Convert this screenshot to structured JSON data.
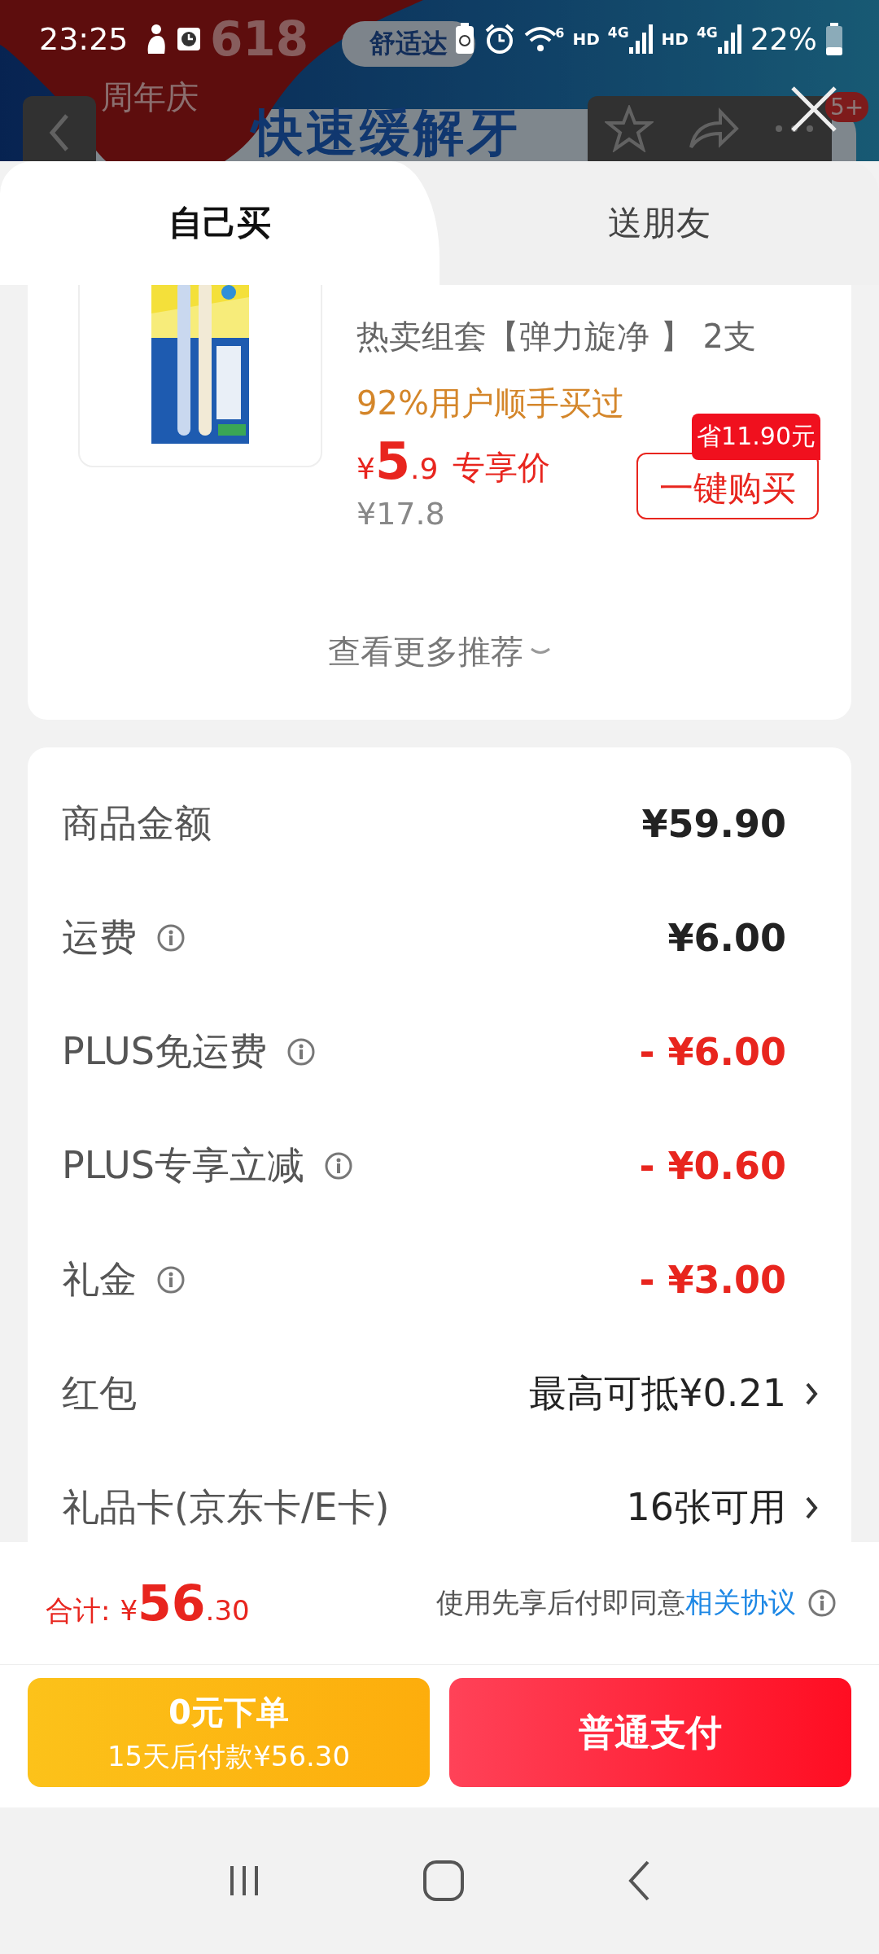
{
  "status_bar": {
    "time": "23:25",
    "wifi_tag": "6",
    "sims": [
      {
        "hd": "HD",
        "gen": "4G"
      },
      {
        "hd": "HD",
        "gen": "4G"
      }
    ],
    "battery": "22%"
  },
  "banner": {
    "badge_number": "618",
    "badge_label": "周年庆",
    "brand": "舒适达",
    "headline": "快速缓解牙",
    "cart_count": "5+"
  },
  "tabs": [
    {
      "label": "自己买",
      "selected": true
    },
    {
      "label": "送朋友",
      "selected": false
    }
  ],
  "product": {
    "kind": "picture",
    "title": "热卖组套【弹力旋净 】 2支",
    "social_proof": "92%用户顺手买过",
    "price": {
      "symbol": "¥",
      "main": "5",
      "fraction": ".9"
    },
    "price_label": "专享价",
    "original_price": "¥17.8",
    "saving_badge": "省11.90元",
    "buy_button": "一键购买",
    "more": "查看更多推荐"
  },
  "cost_rows": [
    {
      "label": "商品金额",
      "info": false,
      "kind": "plain",
      "value": "¥59.90",
      "arrow": false
    },
    {
      "label": "运费",
      "info": true,
      "kind": "plain",
      "value": "¥6.00",
      "arrow": false
    },
    {
      "label": "PLUS免运费",
      "info": true,
      "kind": "discount",
      "value": "- ¥6.00",
      "arrow": false
    },
    {
      "label": "PLUS专享立减",
      "info": true,
      "kind": "discount",
      "value": "- ¥0.60",
      "arrow": false
    },
    {
      "label": "礼金",
      "info": true,
      "kind": "discount",
      "value": "- ¥3.00",
      "arrow": false
    },
    {
      "label": "红包",
      "info": false,
      "kind": "link",
      "value": "最高可抵¥0.21",
      "arrow": true
    },
    {
      "label": "礼品卡(京东卡/E卡)",
      "info": false,
      "kind": "link",
      "value": "16张可用",
      "arrow": true
    }
  ],
  "footer": {
    "total_label": "合计:",
    "total": {
      "symbol": "¥",
      "main": "56",
      "fraction": ".30"
    },
    "agreement": "使用先享后付即同意",
    "agreement_link": "相关协议"
  },
  "actions": [
    {
      "kind": "later",
      "title": "0元下单",
      "subtitle": "15天后付款¥56.30"
    },
    {
      "kind": "pay",
      "title": "普通支付"
    }
  ]
}
